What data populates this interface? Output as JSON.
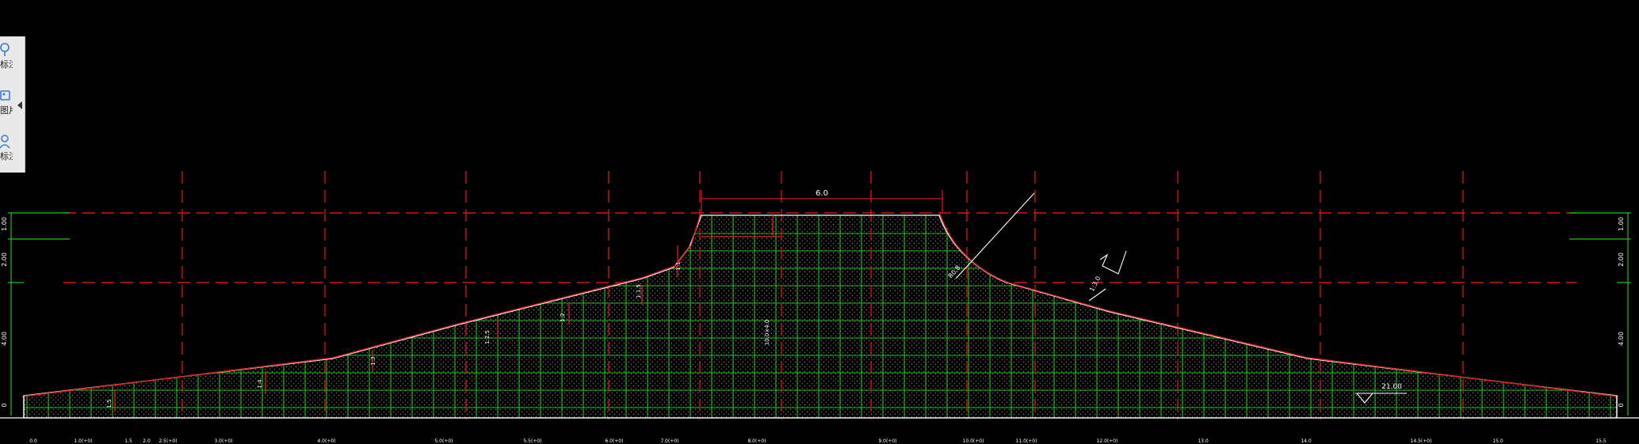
{
  "toolbar": {
    "items": [
      {
        "label": "标注",
        "icon": "pin-icon"
      },
      {
        "label": "图片",
        "icon": "image-icon"
      },
      {
        "label": "标注",
        "icon": "user-annotation-icon"
      }
    ],
    "toggle_icon": "collapse-arrow-icon"
  },
  "drawing": {
    "colors": {
      "background": "#000000",
      "grid": "#19c419",
      "centerline": "#d01515",
      "outline": "#ffffff",
      "dim_text": "#ffffff"
    },
    "crest_dimension": "6.0",
    "left_elevations": [
      "1.00",
      "2.00",
      "4.00",
      "0"
    ],
    "right_elevations": [
      "1.00",
      "2.00",
      "4.00",
      "0"
    ],
    "slope_labels": [
      "1:5",
      "1:4",
      "1:3",
      "1:2.5",
      "1:2",
      "1:1.5",
      "1:1"
    ],
    "center_label": "10.0×4.0",
    "right_slope_label": "1:3.0",
    "annotation_r": "R0.8",
    "base_text": "21.00",
    "station_labels": [
      "0.0",
      "1.0(+0)",
      "1.5",
      "2.0",
      "2.5(+0)",
      "3.0(+0)",
      "4.0(+0)",
      "5.0(+0)",
      "5.5(+0)",
      "6.0(+0)",
      "7.0(+0)",
      "8.0(+0)",
      "9.0(+0)",
      "10.0(+0)",
      "11.0(+0)",
      "12.0(+0)",
      "13.0",
      "14.0",
      "14.5(+0)",
      "15.0",
      "15.5"
    ]
  }
}
